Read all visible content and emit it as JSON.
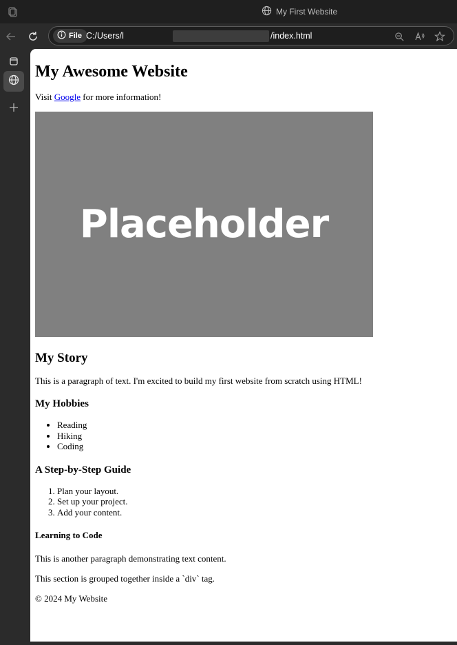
{
  "window": {
    "tab_title": "My First Website"
  },
  "toolbar": {
    "file_chip": "File",
    "url_start": "C:/Users/l",
    "url_end": "/index.html"
  },
  "page": {
    "heading": "My Awesome Website",
    "visit_prefix": "Visit ",
    "visit_link": "Google",
    "visit_suffix": " for more information!",
    "placeholder_text": "Placeholder",
    "story_heading": "My Story",
    "story_paragraph": "This is a paragraph of text. I'm excited to build my first website from scratch using HTML!",
    "hobbies_heading": "My Hobbies",
    "hobbies": [
      "Reading",
      "Hiking",
      "Coding"
    ],
    "guide_heading": "A Step-by-Step Guide",
    "guide_steps": [
      "Plan your layout.",
      "Set up your project.",
      "Add your content."
    ],
    "learning_heading": "Learning to Code",
    "another_paragraph": "This is another paragraph demonstrating text content.",
    "section_paragraph": "This section is grouped together inside a `div` tag.",
    "footer": "© 2024 My Website"
  },
  "colors": {
    "link": "#0000ee",
    "placeholder_bg": "#808080"
  }
}
